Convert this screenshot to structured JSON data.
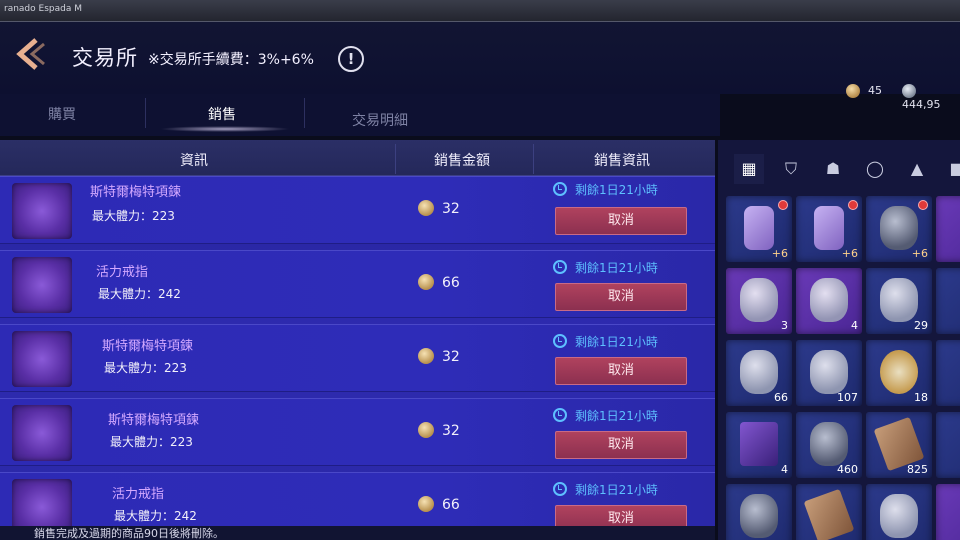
{
  "window": {
    "title": "ranado Espada M"
  },
  "header": {
    "title": "交易所",
    "fee_text": "※交易所手續費：3%+6%",
    "info_label": "!",
    "currency_gold": "45",
    "currency_silver": "444,95"
  },
  "tabs": [
    {
      "label": "購買"
    },
    {
      "label": "銷售"
    },
    {
      "label": "交易明細"
    }
  ],
  "table": {
    "headers": {
      "info": "資訊",
      "price": "銷售金額",
      "sale_info": "銷售資訊"
    },
    "rows": [
      {
        "name": "斯特爾梅特項鍊",
        "stat": "最大體力：223",
        "price": "32",
        "timer": "剩餘1日21小時",
        "action": "取消"
      },
      {
        "name": "活力戒指",
        "stat": "最大體力：242",
        "price": "66",
        "timer": "剩餘1日21小時",
        "action": "取消"
      },
      {
        "name": "斯特爾梅特項鍊",
        "stat": "最大體力：223",
        "price": "32",
        "timer": "剩餘1日21小時",
        "action": "取消"
      },
      {
        "name": "斯特爾梅特項鍊",
        "stat": "最大體力：223",
        "price": "32",
        "timer": "剩餘1日21小時",
        "action": "取消"
      },
      {
        "name": "活力戒指",
        "stat": "最大體力：242",
        "price": "66",
        "timer": "剩餘1日21小時",
        "action": "取消"
      }
    ]
  },
  "footer": {
    "text": "銷售完成及過期的商品90日後將刪除。"
  },
  "inventory": {
    "tabs": [
      "grid-icon",
      "armor-icon",
      "helmet-icon",
      "necklace-icon",
      "cloak-icon",
      "bag-icon"
    ],
    "slots": [
      {
        "label": "+6",
        "type": "plus"
      },
      {
        "label": "+6",
        "type": "plus"
      },
      {
        "label": "+6",
        "type": "plus"
      },
      {
        "label": "",
        "type": "none"
      },
      {
        "label": "3",
        "type": "count"
      },
      {
        "label": "4",
        "type": "count"
      },
      {
        "label": "29",
        "type": "count"
      },
      {
        "label": "",
        "type": "none"
      },
      {
        "label": "66",
        "type": "count"
      },
      {
        "label": "107",
        "type": "count"
      },
      {
        "label": "18",
        "type": "count"
      },
      {
        "label": "",
        "type": "none"
      },
      {
        "label": "4",
        "type": "count"
      },
      {
        "label": "460",
        "type": "count"
      },
      {
        "label": "825",
        "type": "count"
      },
      {
        "label": "",
        "type": "none"
      }
    ]
  }
}
